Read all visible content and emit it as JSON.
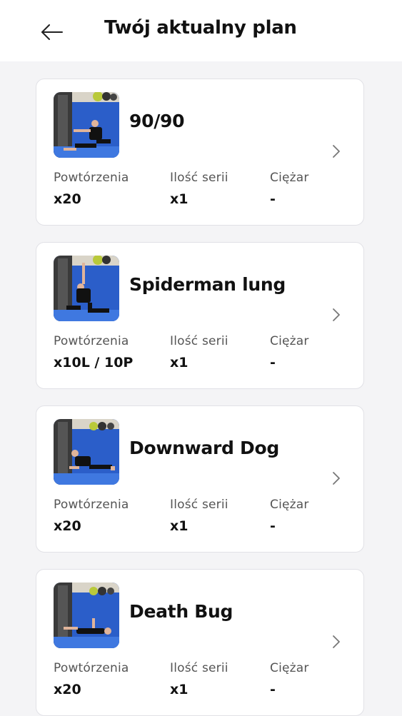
{
  "header": {
    "title": "Twój aktualny plan"
  },
  "stat_labels": {
    "reps": "Powtórzenia",
    "sets": "Ilość serii",
    "weight": "Ciężar"
  },
  "exercises": [
    {
      "name": "90/90",
      "reps": "x20",
      "sets": "x1",
      "weight": "-"
    },
    {
      "name": "Spiderman lung",
      "reps": "x10L / 10P",
      "sets": "x1",
      "weight": "-"
    },
    {
      "name": "Downward Dog",
      "reps": "x20",
      "sets": "x1",
      "weight": "-"
    },
    {
      "name": "Death Bug",
      "reps": "x20",
      "sets": "x1",
      "weight": "-"
    }
  ],
  "icons": {
    "back": "arrow-left-icon",
    "chevron": "chevron-right-icon"
  },
  "colors": {
    "background": "#f4f4f6",
    "card": "#ffffff",
    "text": "#111111",
    "label": "#555555",
    "thumb_wall": "#2b5ec9"
  }
}
